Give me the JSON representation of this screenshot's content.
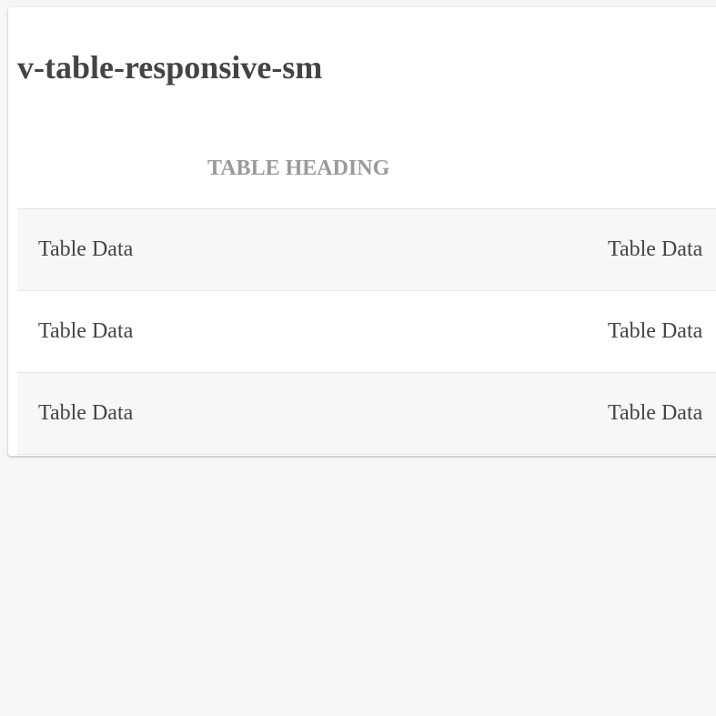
{
  "page": {
    "title": "v-table-responsive-sm"
  },
  "table": {
    "headers": [
      "TABLE HEADING",
      ""
    ],
    "rows": [
      [
        "Table Data",
        "Table Data"
      ],
      [
        "Table Data",
        "Table Data"
      ],
      [
        "Table Data",
        "Table Data"
      ]
    ]
  },
  "colors": {
    "background": "#f6f6f6",
    "card": "#ffffff",
    "text": "#444444",
    "heading_text": "#9a9a9a",
    "stripe": "#f7f7f7",
    "border": "#e4e4e4"
  }
}
